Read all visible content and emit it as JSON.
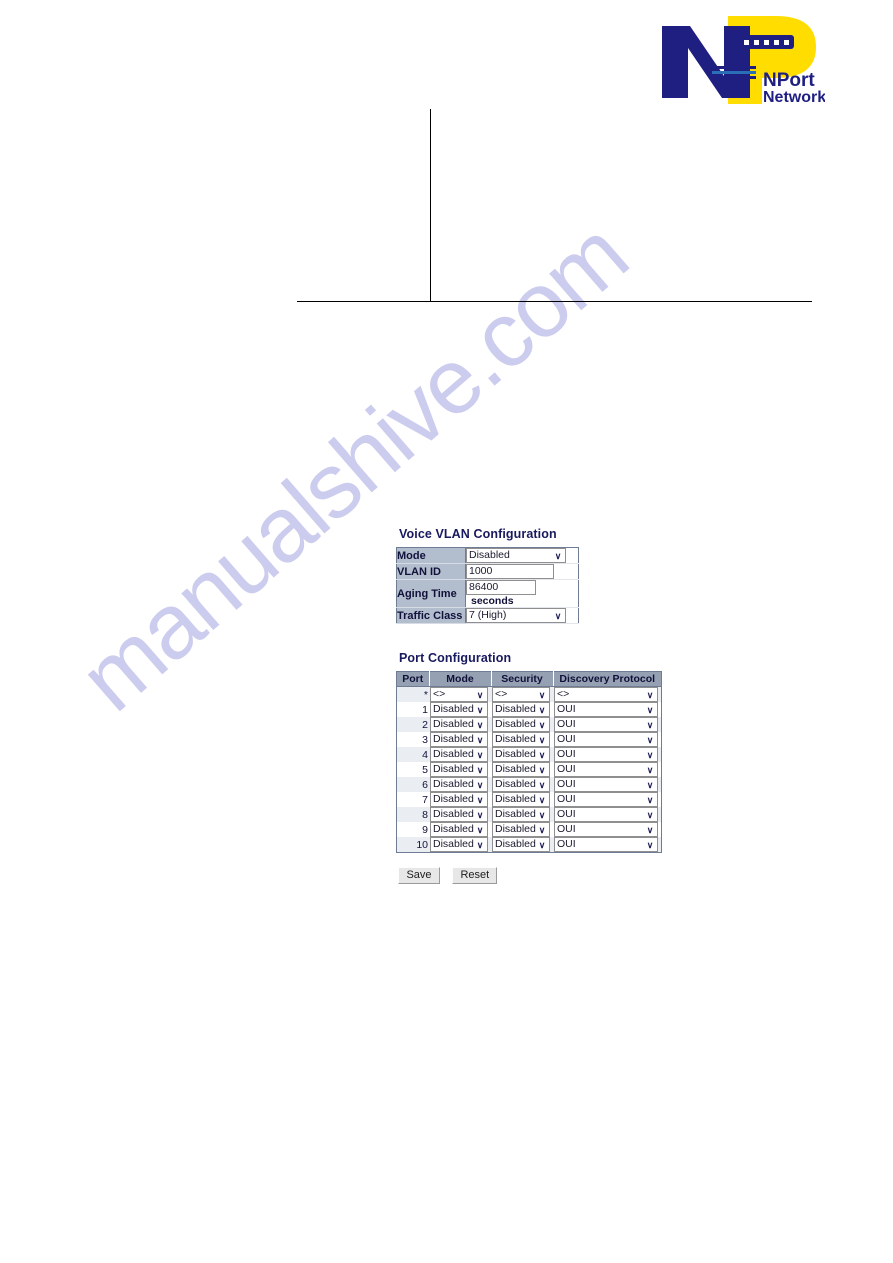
{
  "page": {
    "watermark": "manualshive.com",
    "background_color": "#ffffff"
  },
  "logo": {
    "brand_line1": "NPort",
    "brand_line2": "Networks",
    "letter_n": "N",
    "letter_p": "P",
    "blue": "#1f1f82",
    "yellow": "#ffdd00",
    "dot_count": 5
  },
  "voice_vlan": {
    "title": "Voice VLAN Configuration",
    "rows": [
      {
        "label": "Mode",
        "control": "select",
        "value": "Disabled"
      },
      {
        "label": "VLAN ID",
        "control": "text",
        "value": "1000"
      },
      {
        "label": "Aging Time",
        "control": "text",
        "value": "86400",
        "unit": "seconds"
      },
      {
        "label": "Traffic Class",
        "control": "select",
        "value": "7 (High)"
      }
    ]
  },
  "port_configuration": {
    "title": "Port Configuration",
    "columns": [
      "Port",
      "Mode",
      "Security",
      "Discovery Protocol"
    ],
    "rows": [
      {
        "port": "*",
        "mode": "<>",
        "security": "<>",
        "discovery": "<>"
      },
      {
        "port": "1",
        "mode": "Disabled",
        "security": "Disabled",
        "discovery": "OUI"
      },
      {
        "port": "2",
        "mode": "Disabled",
        "security": "Disabled",
        "discovery": "OUI"
      },
      {
        "port": "3",
        "mode": "Disabled",
        "security": "Disabled",
        "discovery": "OUI"
      },
      {
        "port": "4",
        "mode": "Disabled",
        "security": "Disabled",
        "discovery": "OUI"
      },
      {
        "port": "5",
        "mode": "Disabled",
        "security": "Disabled",
        "discovery": "OUI"
      },
      {
        "port": "6",
        "mode": "Disabled",
        "security": "Disabled",
        "discovery": "OUI"
      },
      {
        "port": "7",
        "mode": "Disabled",
        "security": "Disabled",
        "discovery": "OUI"
      },
      {
        "port": "8",
        "mode": "Disabled",
        "security": "Disabled",
        "discovery": "OUI"
      },
      {
        "port": "9",
        "mode": "Disabled",
        "security": "Disabled",
        "discovery": "OUI"
      },
      {
        "port": "10",
        "mode": "Disabled",
        "security": "Disabled",
        "discovery": "OUI"
      }
    ]
  },
  "buttons": {
    "save": "Save",
    "reset": "Reset"
  },
  "icons": {
    "caret": "∨"
  }
}
